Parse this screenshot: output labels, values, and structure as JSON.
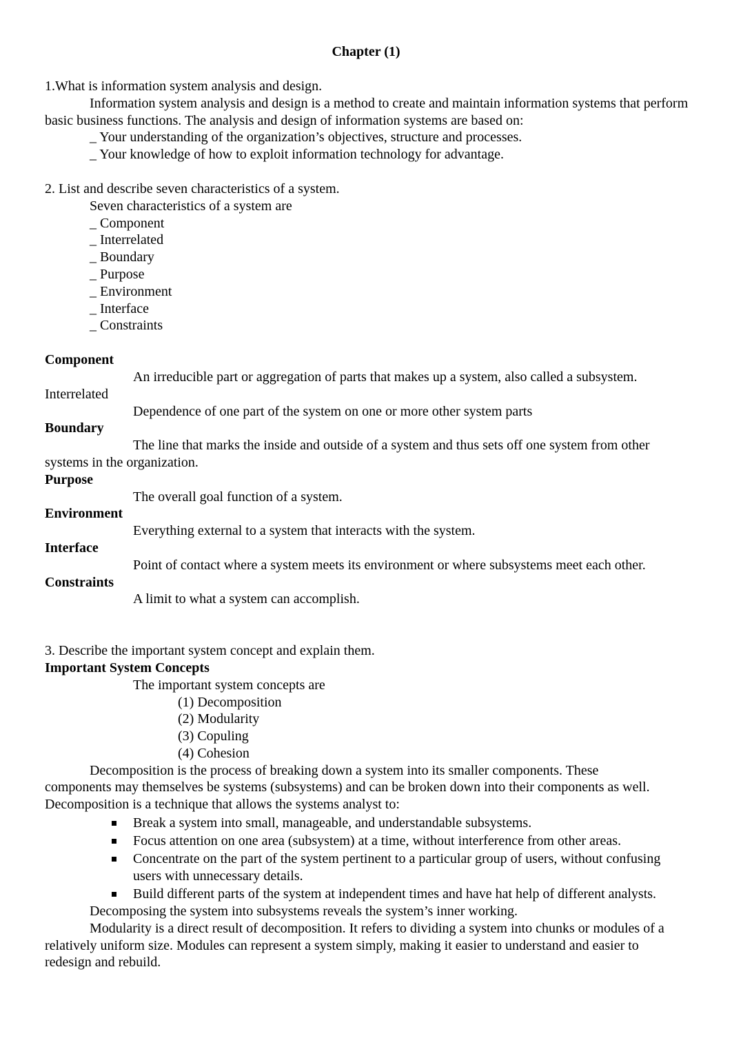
{
  "title": "Chapter (1)",
  "q1": {
    "question": "1.What is information system analysis and design.",
    "answer": "Information system analysis and design is a method to create and maintain information systems that perform basic business functions. The analysis and design of information systems are based on:",
    "points": [
      "_ Your understanding of the organization’s objectives, structure and processes.",
      "_ Your knowledge of how to exploit information technology for advantage."
    ]
  },
  "q2": {
    "question": "2. List and describe seven characteristics of a system.",
    "intro": "Seven characteristics of a system are",
    "list": [
      "_ Component",
      "_ Interrelated",
      "_ Boundary",
      "_ Purpose",
      "_ Environment",
      "_ Interface",
      "_ Constraints"
    ],
    "definitions": [
      {
        "term": "Component",
        "bold": true,
        "definition": "An irreducible part or aggregation of parts that makes up a system, also called a subsystem."
      },
      {
        "term": "Interrelated",
        "bold": false,
        "definition": "Dependence of one part of the system on one or more other system parts"
      },
      {
        "term": "Boundary",
        "bold": true,
        "definition": "The line that marks the inside and outside of a system and thus sets off one system from other systems in the organization."
      },
      {
        "term": "Purpose",
        "bold": true,
        "definition": "The overall goal function of a system."
      },
      {
        "term": "Environment",
        "bold": true,
        "definition": "Everything external to a system that interacts with the system."
      },
      {
        "term": "Interface",
        "bold": true,
        "definition": "Point of contact where a system meets its environment or where subsystems meet each other."
      },
      {
        "term": "Constraints",
        "bold": true,
        "definition": "A limit to what a system can accomplish."
      }
    ]
  },
  "q3": {
    "question": "3. Describe the important system concept and explain them.",
    "heading": "Important System Concepts",
    "intro": "The important system concepts are",
    "concepts": [
      "(1) Decomposition",
      "(2) Modularity",
      "(3) Copuling",
      "(4) Cohesion"
    ],
    "decomposition_para": "Decomposition is the process of breaking down a system into its smaller components. These components may themselves be systems (subsystems) and can be broken down into their components as well. Decomposition is a technique that allows the systems analyst to:",
    "bullets": [
      "Break a system into small, manageable, and understandable subsystems.",
      "Focus attention on one area (subsystem) at a time, without interference from other areas.",
      "Concentrate on the part of the system pertinent to a particular group of users, without confusing users with unnecessary details.",
      "Build different parts of the system at independent times and have hat help of different analysts."
    ],
    "decomposing_note": "Decomposing the system into subsystems reveals the system’s inner working.",
    "modularity_para": "Modularity is a direct result of decomposition. It refers to dividing a system into chunks or modules of a relatively uniform size. Modules can represent a system simply, making it easier to understand and easier to redesign and rebuild."
  }
}
